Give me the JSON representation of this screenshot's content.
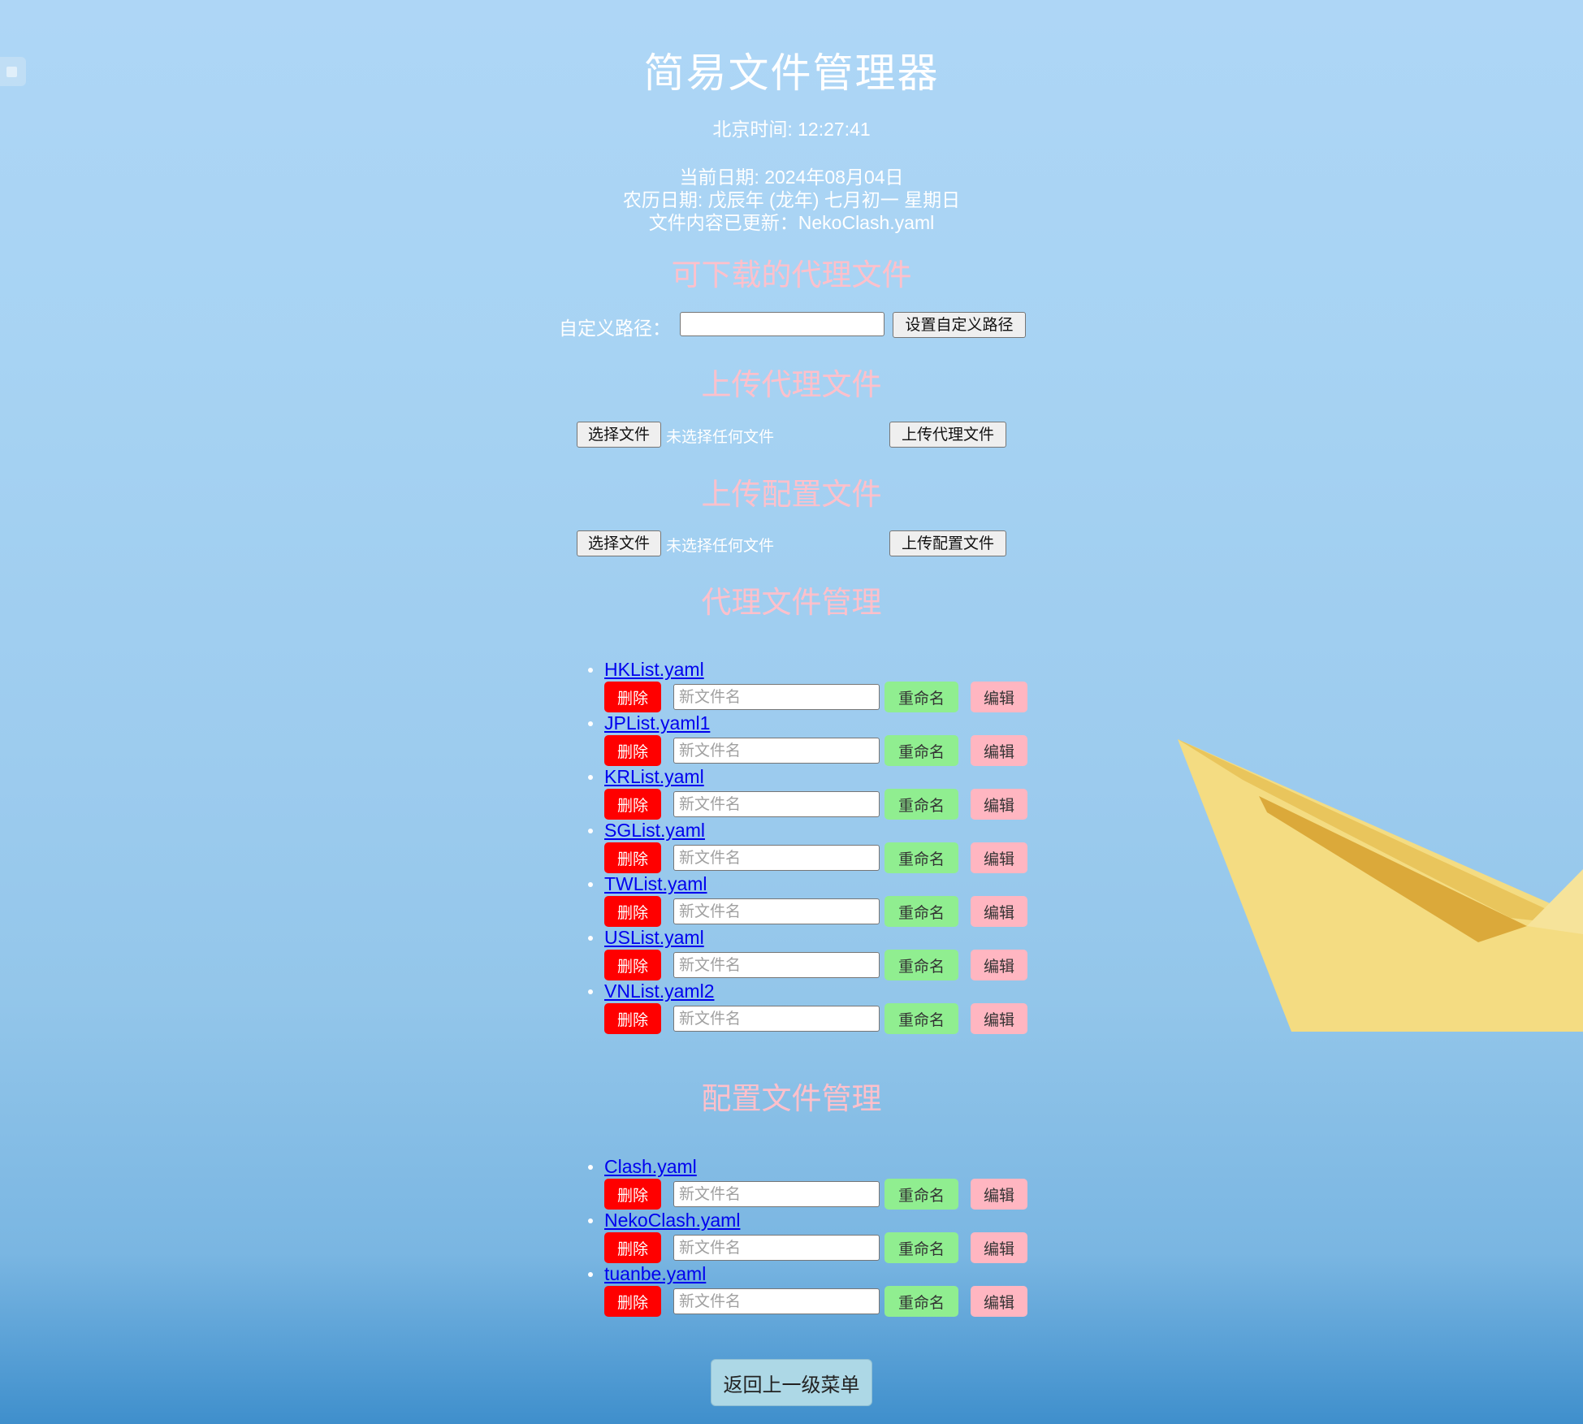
{
  "title": "简易文件管理器",
  "info": {
    "beijing_time": "北京时间: 12:27:41",
    "current_date": "当前日期: 2024年08月04日",
    "lunar_date": "农历日期: 戊辰年 (龙年) 七月初一 星期日",
    "update_notice": "文件内容已更新：NekoClash.yaml"
  },
  "sections": {
    "downloadable": "可下载的代理文件",
    "upload_proxy": "上传代理文件",
    "upload_config": "上传配置文件",
    "proxy_manage": "代理文件管理",
    "config_manage": "配置文件管理"
  },
  "path": {
    "label": "自定义路径：",
    "value": "",
    "button": "设置自定义路径"
  },
  "upload_proxy": {
    "choose": "选择文件",
    "status": "未选择任何文件",
    "submit": "上传代理文件"
  },
  "upload_config": {
    "choose": "选择文件",
    "status": "未选择任何文件",
    "submit": "上传配置文件"
  },
  "actions": {
    "delete": "删除",
    "placeholder": "新文件名",
    "rename": "重命名",
    "edit": "编辑"
  },
  "proxy_files": [
    "HKList.yaml",
    "JPList.yaml1",
    "KRList.yaml",
    "SGList.yaml",
    "TWList.yaml",
    "USList.yaml",
    "VNList.yaml2"
  ],
  "config_files": [
    "Clash.yaml",
    "NekoClash.yaml",
    "tuanbe.yaml"
  ],
  "back_button": "返回上一级菜单",
  "colors": {
    "section_title": "#ffc0cb",
    "delete": "#ff0000",
    "rename": "#90ee90",
    "edit": "#ffb6c1",
    "back": "#add8e6",
    "link": "#0000ee"
  }
}
